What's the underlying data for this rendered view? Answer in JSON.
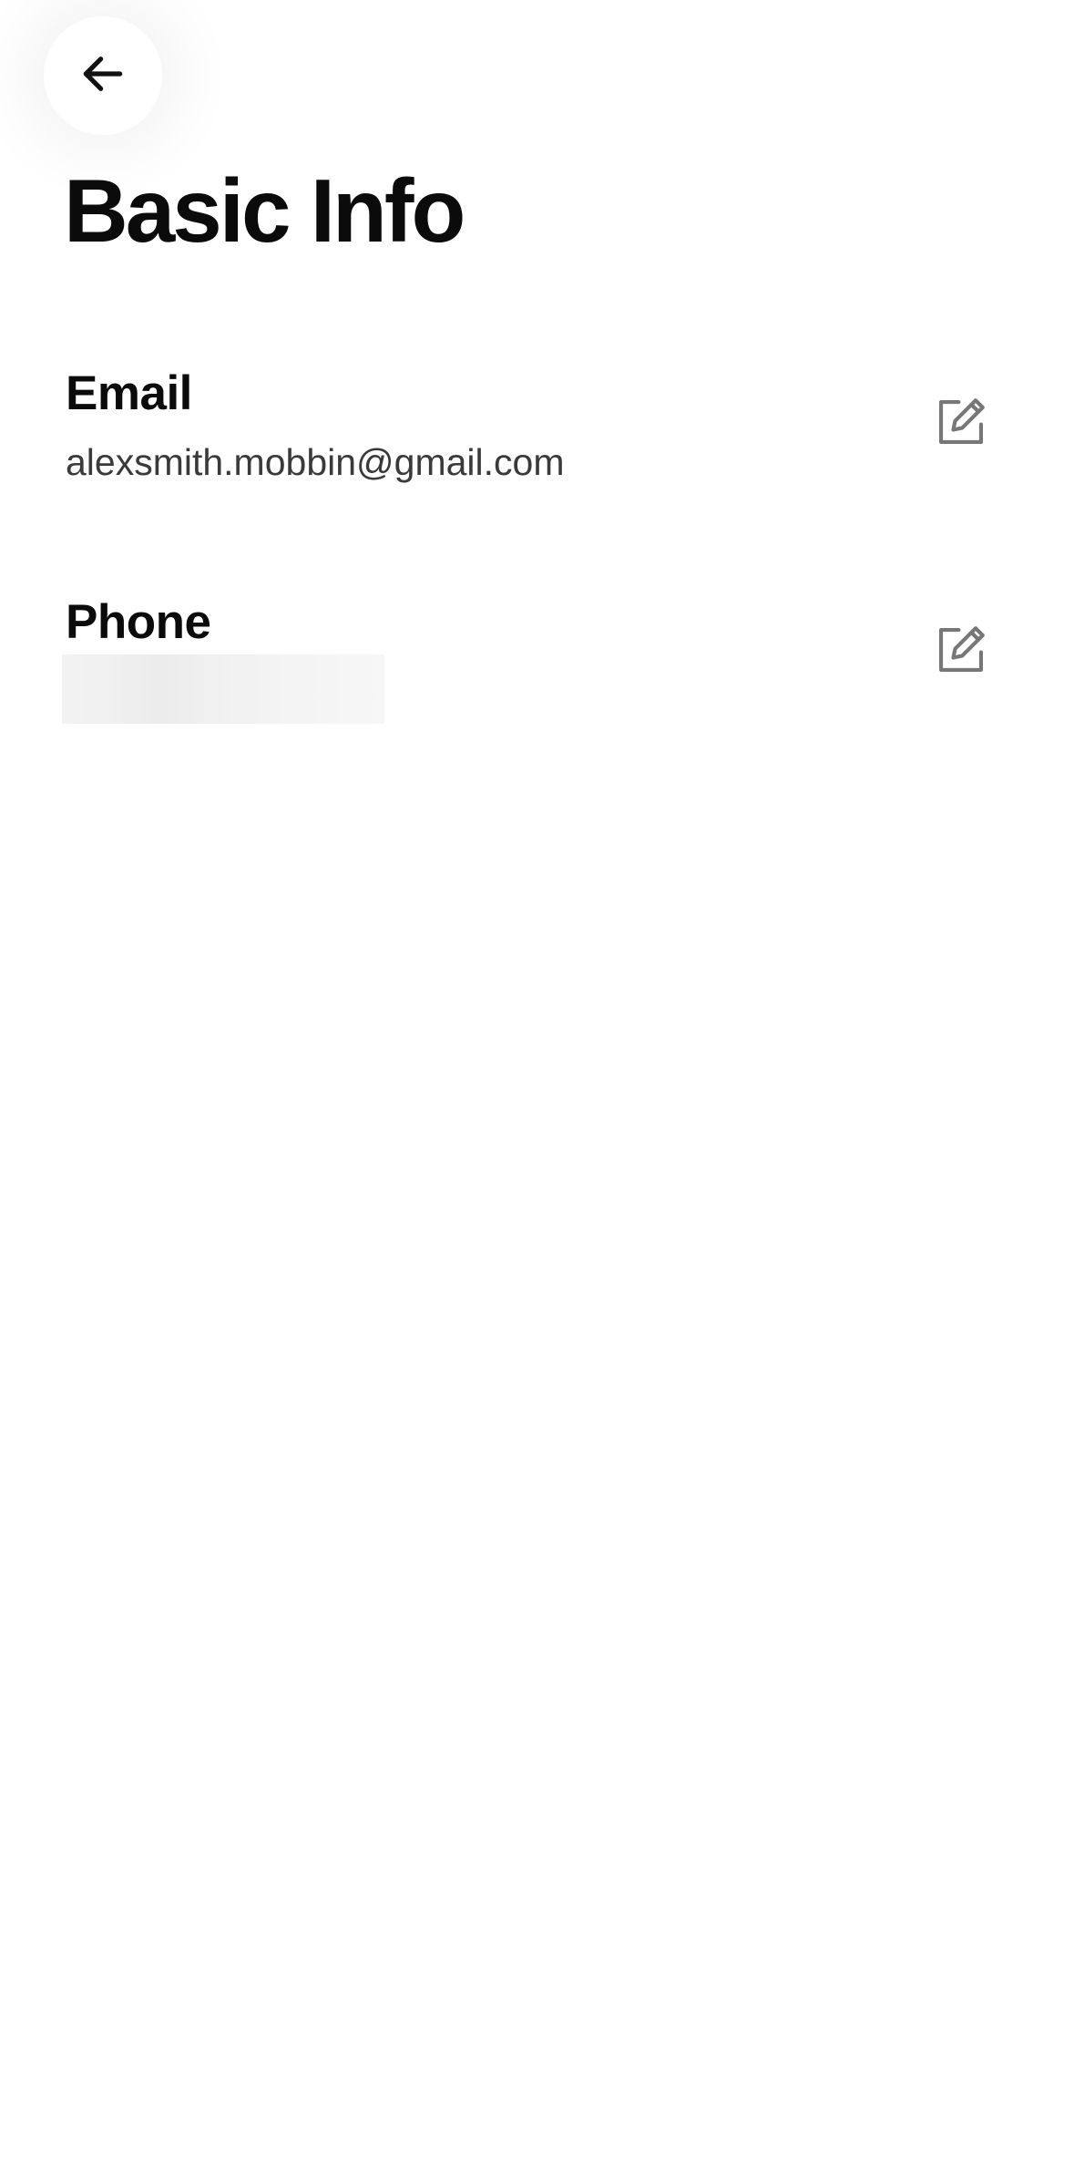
{
  "header": {
    "back_icon": "arrow-left-icon",
    "title": "Basic Info"
  },
  "fields": {
    "email": {
      "label": "Email",
      "value": "alexsmith.mobbin@gmail.com",
      "edit_icon": "edit-icon"
    },
    "phone": {
      "label": "Phone",
      "value": "",
      "value_redacted": true,
      "edit_icon": "edit-icon"
    }
  },
  "colors": {
    "background": "#ffffff",
    "text_primary": "#0b0b0b",
    "text_secondary": "#3a3a3a",
    "icon_gray": "#777777"
  }
}
